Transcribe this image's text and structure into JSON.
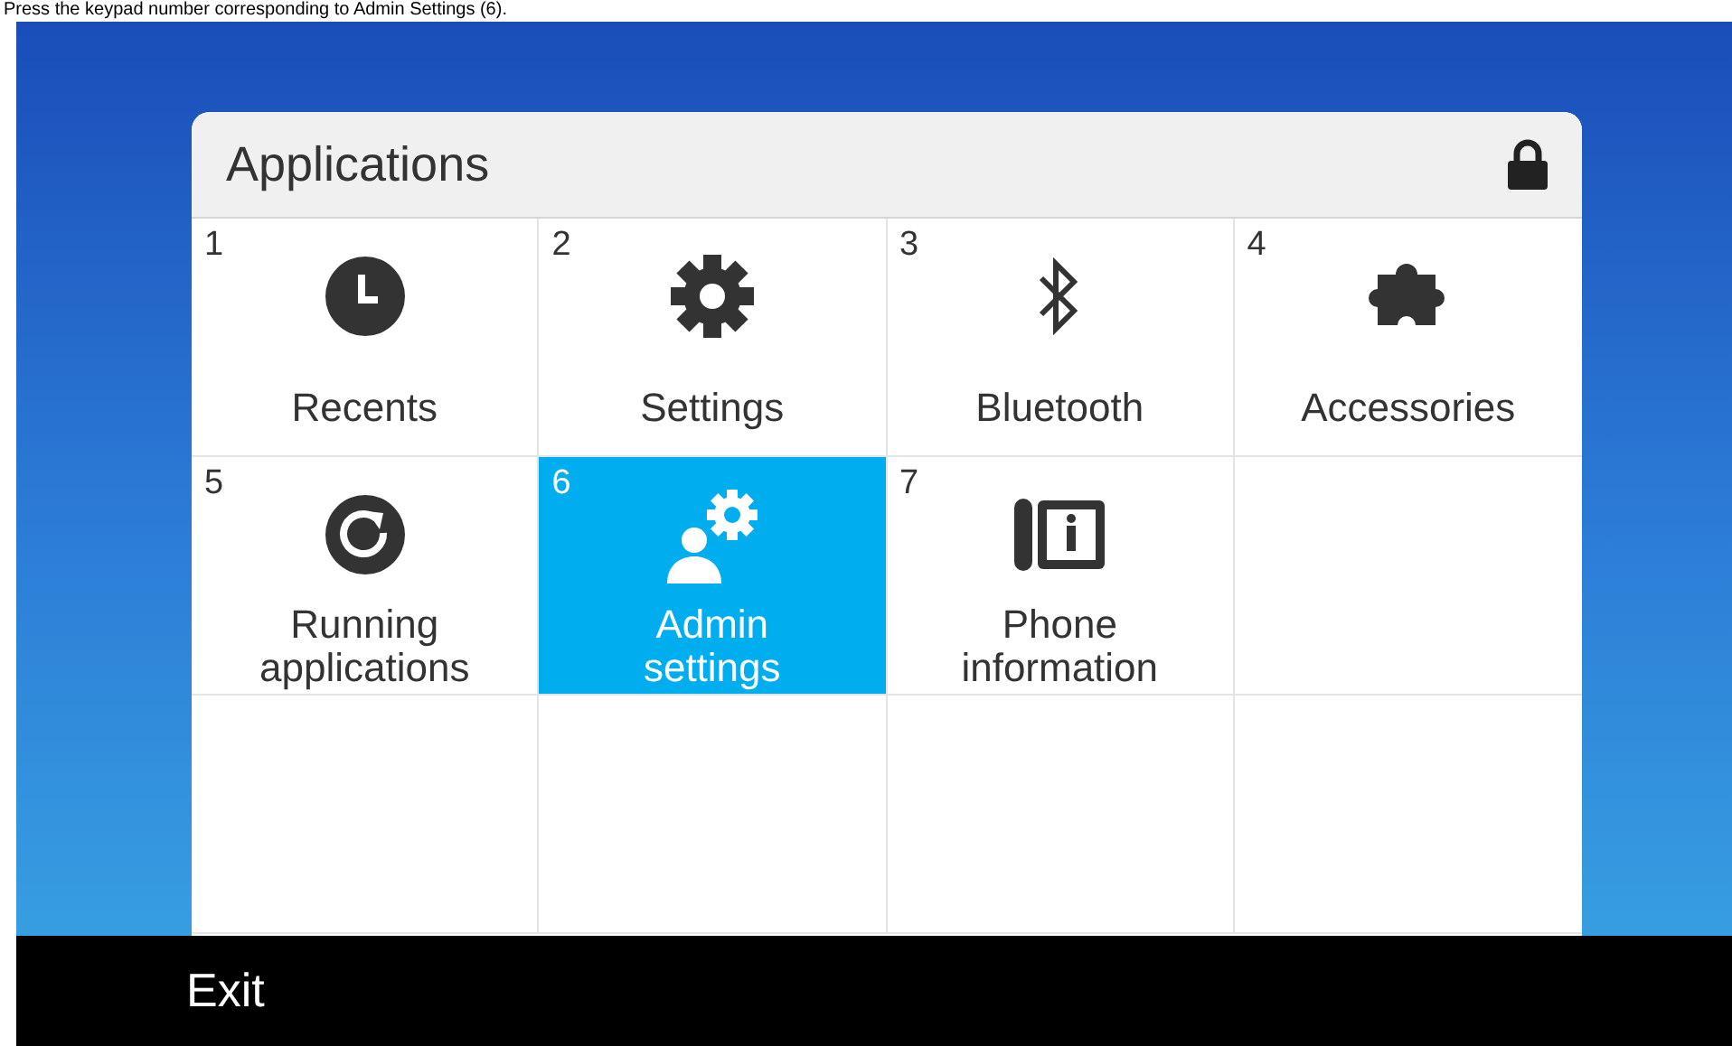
{
  "caption": "Press the keypad number corresponding to Admin Settings (6).",
  "panel": {
    "title": "Applications",
    "locked": true,
    "items": [
      {
        "number": "1",
        "label": "Recents",
        "selected": false
      },
      {
        "number": "2",
        "label": "Settings",
        "selected": false
      },
      {
        "number": "3",
        "label": "Bluetooth",
        "selected": false
      },
      {
        "number": "4",
        "label": "Accessories",
        "selected": false
      },
      {
        "number": "5",
        "label": "Running applications",
        "selected": false
      },
      {
        "number": "6",
        "label": "Admin settings",
        "selected": true
      },
      {
        "number": "7",
        "label": "Phone information",
        "selected": false
      }
    ]
  },
  "softkeys": [
    "Exit"
  ]
}
